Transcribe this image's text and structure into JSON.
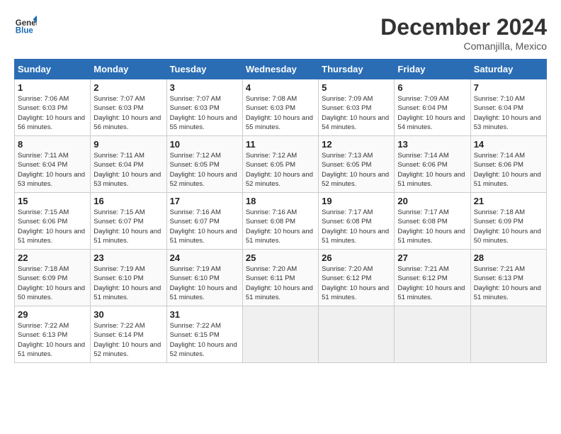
{
  "header": {
    "logo_line1": "General",
    "logo_line2": "Blue",
    "title": "December 2024",
    "subtitle": "Comanjilla, Mexico"
  },
  "columns": [
    "Sunday",
    "Monday",
    "Tuesday",
    "Wednesday",
    "Thursday",
    "Friday",
    "Saturday"
  ],
  "weeks": [
    [
      {
        "day": "1",
        "sunrise": "Sunrise: 7:06 AM",
        "sunset": "Sunset: 6:03 PM",
        "daylight": "Daylight: 10 hours and 56 minutes."
      },
      {
        "day": "2",
        "sunrise": "Sunrise: 7:07 AM",
        "sunset": "Sunset: 6:03 PM",
        "daylight": "Daylight: 10 hours and 56 minutes."
      },
      {
        "day": "3",
        "sunrise": "Sunrise: 7:07 AM",
        "sunset": "Sunset: 6:03 PM",
        "daylight": "Daylight: 10 hours and 55 minutes."
      },
      {
        "day": "4",
        "sunrise": "Sunrise: 7:08 AM",
        "sunset": "Sunset: 6:03 PM",
        "daylight": "Daylight: 10 hours and 55 minutes."
      },
      {
        "day": "5",
        "sunrise": "Sunrise: 7:09 AM",
        "sunset": "Sunset: 6:03 PM",
        "daylight": "Daylight: 10 hours and 54 minutes."
      },
      {
        "day": "6",
        "sunrise": "Sunrise: 7:09 AM",
        "sunset": "Sunset: 6:04 PM",
        "daylight": "Daylight: 10 hours and 54 minutes."
      },
      {
        "day": "7",
        "sunrise": "Sunrise: 7:10 AM",
        "sunset": "Sunset: 6:04 PM",
        "daylight": "Daylight: 10 hours and 53 minutes."
      }
    ],
    [
      {
        "day": "8",
        "sunrise": "Sunrise: 7:11 AM",
        "sunset": "Sunset: 6:04 PM",
        "daylight": "Daylight: 10 hours and 53 minutes."
      },
      {
        "day": "9",
        "sunrise": "Sunrise: 7:11 AM",
        "sunset": "Sunset: 6:04 PM",
        "daylight": "Daylight: 10 hours and 53 minutes."
      },
      {
        "day": "10",
        "sunrise": "Sunrise: 7:12 AM",
        "sunset": "Sunset: 6:05 PM",
        "daylight": "Daylight: 10 hours and 52 minutes."
      },
      {
        "day": "11",
        "sunrise": "Sunrise: 7:12 AM",
        "sunset": "Sunset: 6:05 PM",
        "daylight": "Daylight: 10 hours and 52 minutes."
      },
      {
        "day": "12",
        "sunrise": "Sunrise: 7:13 AM",
        "sunset": "Sunset: 6:05 PM",
        "daylight": "Daylight: 10 hours and 52 minutes."
      },
      {
        "day": "13",
        "sunrise": "Sunrise: 7:14 AM",
        "sunset": "Sunset: 6:06 PM",
        "daylight": "Daylight: 10 hours and 51 minutes."
      },
      {
        "day": "14",
        "sunrise": "Sunrise: 7:14 AM",
        "sunset": "Sunset: 6:06 PM",
        "daylight": "Daylight: 10 hours and 51 minutes."
      }
    ],
    [
      {
        "day": "15",
        "sunrise": "Sunrise: 7:15 AM",
        "sunset": "Sunset: 6:06 PM",
        "daylight": "Daylight: 10 hours and 51 minutes."
      },
      {
        "day": "16",
        "sunrise": "Sunrise: 7:15 AM",
        "sunset": "Sunset: 6:07 PM",
        "daylight": "Daylight: 10 hours and 51 minutes."
      },
      {
        "day": "17",
        "sunrise": "Sunrise: 7:16 AM",
        "sunset": "Sunset: 6:07 PM",
        "daylight": "Daylight: 10 hours and 51 minutes."
      },
      {
        "day": "18",
        "sunrise": "Sunrise: 7:16 AM",
        "sunset": "Sunset: 6:08 PM",
        "daylight": "Daylight: 10 hours and 51 minutes."
      },
      {
        "day": "19",
        "sunrise": "Sunrise: 7:17 AM",
        "sunset": "Sunset: 6:08 PM",
        "daylight": "Daylight: 10 hours and 51 minutes."
      },
      {
        "day": "20",
        "sunrise": "Sunrise: 7:17 AM",
        "sunset": "Sunset: 6:08 PM",
        "daylight": "Daylight: 10 hours and 51 minutes."
      },
      {
        "day": "21",
        "sunrise": "Sunrise: 7:18 AM",
        "sunset": "Sunset: 6:09 PM",
        "daylight": "Daylight: 10 hours and 50 minutes."
      }
    ],
    [
      {
        "day": "22",
        "sunrise": "Sunrise: 7:18 AM",
        "sunset": "Sunset: 6:09 PM",
        "daylight": "Daylight: 10 hours and 50 minutes."
      },
      {
        "day": "23",
        "sunrise": "Sunrise: 7:19 AM",
        "sunset": "Sunset: 6:10 PM",
        "daylight": "Daylight: 10 hours and 51 minutes."
      },
      {
        "day": "24",
        "sunrise": "Sunrise: 7:19 AM",
        "sunset": "Sunset: 6:10 PM",
        "daylight": "Daylight: 10 hours and 51 minutes."
      },
      {
        "day": "25",
        "sunrise": "Sunrise: 7:20 AM",
        "sunset": "Sunset: 6:11 PM",
        "daylight": "Daylight: 10 hours and 51 minutes."
      },
      {
        "day": "26",
        "sunrise": "Sunrise: 7:20 AM",
        "sunset": "Sunset: 6:12 PM",
        "daylight": "Daylight: 10 hours and 51 minutes."
      },
      {
        "day": "27",
        "sunrise": "Sunrise: 7:21 AM",
        "sunset": "Sunset: 6:12 PM",
        "daylight": "Daylight: 10 hours and 51 minutes."
      },
      {
        "day": "28",
        "sunrise": "Sunrise: 7:21 AM",
        "sunset": "Sunset: 6:13 PM",
        "daylight": "Daylight: 10 hours and 51 minutes."
      }
    ],
    [
      {
        "day": "29",
        "sunrise": "Sunrise: 7:22 AM",
        "sunset": "Sunset: 6:13 PM",
        "daylight": "Daylight: 10 hours and 51 minutes."
      },
      {
        "day": "30",
        "sunrise": "Sunrise: 7:22 AM",
        "sunset": "Sunset: 6:14 PM",
        "daylight": "Daylight: 10 hours and 52 minutes."
      },
      {
        "day": "31",
        "sunrise": "Sunrise: 7:22 AM",
        "sunset": "Sunset: 6:15 PM",
        "daylight": "Daylight: 10 hours and 52 minutes."
      },
      null,
      null,
      null,
      null
    ]
  ]
}
